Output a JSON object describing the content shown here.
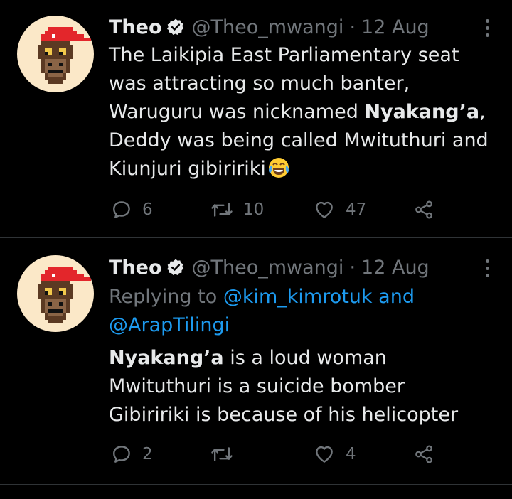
{
  "colors": {
    "background": "#000000",
    "text": "#e7e9ea",
    "muted": "#71767b",
    "link": "#1d9bf0",
    "verified": "#e7e9ea",
    "cap": "#e3262b"
  },
  "tweets": [
    {
      "author": {
        "name": "Theo",
        "handle": "@Theo_mwangi",
        "date": "12 Aug",
        "avatar_icon": "pixel-ape-red-cap-avatar",
        "verified_icon": "verified-badge-icon"
      },
      "text_lines": [
        {
          "parts": [
            {
              "t": "The Laikipia East Parliamentary seat"
            }
          ]
        },
        {
          "parts": [
            {
              "t": "was attracting so much banter,"
            }
          ]
        },
        {
          "parts": [
            {
              "t": "Waruguru was nicknamed "
            },
            {
              "t": "Nyakang’a",
              "bold": true
            },
            {
              "t": ","
            }
          ]
        },
        {
          "parts": [
            {
              "t": "Deddy was being called Mwituthuri and"
            }
          ]
        },
        {
          "parts": [
            {
              "t": "Kiunjuri gibiririki"
            }
          ],
          "emoji": "face-with-tears-of-joy-emoji"
        }
      ],
      "actions": {
        "replies": "6",
        "retweets": "10",
        "likes": "47"
      }
    },
    {
      "author": {
        "name": "Theo",
        "handle": "@Theo_mwangi",
        "date": "12 Aug",
        "avatar_icon": "pixel-ape-red-cap-avatar",
        "verified_icon": "verified-badge-icon"
      },
      "reply_to": {
        "prefix": "Replying to",
        "users": [
          "@kim_kimrotuk"
        ],
        "joiner": "and",
        "last_user": "@ArapTilingi"
      },
      "text_lines": [
        {
          "parts": [
            {
              "t": "Nyakang’a",
              "bold": true
            },
            {
              "t": " is a loud woman"
            }
          ]
        },
        {
          "parts": [
            {
              "t": "Mwituthuri is a suicide bomber"
            }
          ]
        },
        {
          "parts": [
            {
              "t": "Gibiririki is because of his helicopter"
            }
          ]
        }
      ],
      "actions": {
        "replies": "2",
        "retweets": "",
        "likes": "4"
      }
    }
  ],
  "icons": {
    "more": "more-dots-icon",
    "reply": "reply-icon",
    "retweet": "retweet-icon",
    "like": "like-icon",
    "share": "share-icon"
  }
}
